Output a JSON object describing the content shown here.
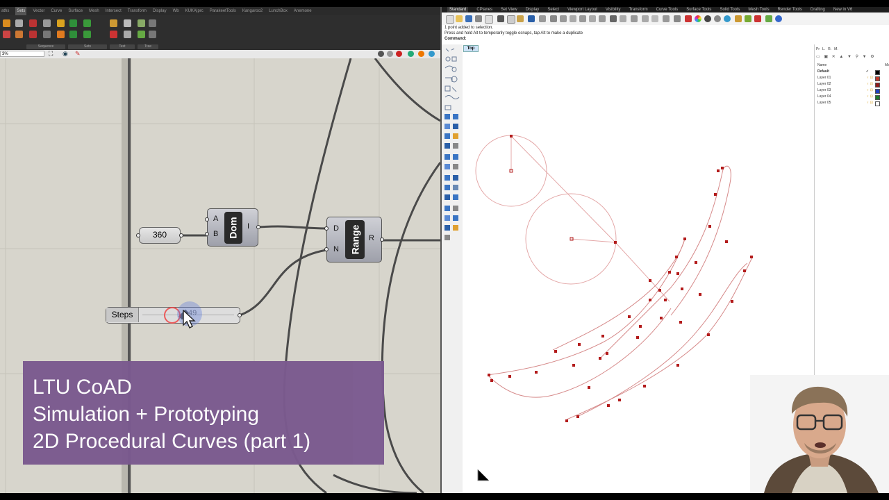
{
  "grasshopper": {
    "tabs": [
      "aths",
      "Sets",
      "Vector",
      "Curve",
      "Surface",
      "Mesh",
      "Intersect",
      "Transform",
      "Display",
      "Wb",
      "KUKA|prc",
      "ParakeetTools",
      "Kangaroo2",
      "LunchBox",
      "Anemone"
    ],
    "active_tab": "Sets",
    "ribbon_groups": [
      "Sequence",
      "Sets",
      "Text",
      "Tree"
    ],
    "zoom_value": "3%",
    "components": {
      "number_panel": "360",
      "domain": {
        "label": "Dom",
        "in_a": "A",
        "in_b": "B",
        "out": "I"
      },
      "range": {
        "label": "Range",
        "in_d": "D",
        "in_n": "N",
        "out": "R"
      },
      "slider": {
        "label": "Steps",
        "value": "49"
      }
    }
  },
  "rhino": {
    "tabs": [
      "Standard",
      "CPlanes",
      "Set View",
      "Display",
      "Select",
      "Viewport Layout",
      "Visibility",
      "Transform",
      "Curve Tools",
      "Surface Tools",
      "Solid Tools",
      "Mesh Tools",
      "Render Tools",
      "Drafting",
      "New in V6"
    ],
    "active_tab": "Standard",
    "command_history": [
      "1 point added to selection.",
      "Press and hold Alt to temporarily toggle osnaps, tap Alt to make a duplicate"
    ],
    "command_prompt": "Command:",
    "viewport_label": "Top",
    "panel_tabs": [
      "Pr",
      "L.",
      "R.",
      "M."
    ],
    "layers_header": {
      "name": "Name",
      "material": "Ma"
    },
    "layers": [
      {
        "name": "Default",
        "color": "#000000",
        "current": true
      },
      {
        "name": "Layer 01",
        "color": "#c0392b",
        "current": false
      },
      {
        "name": "Layer 02",
        "color": "#8e1b1b",
        "current": false
      },
      {
        "name": "Layer 03",
        "color": "#1f3fbf",
        "current": false
      },
      {
        "name": "Layer 04",
        "color": "#1d7a2a",
        "current": false
      },
      {
        "name": "Layer 05",
        "color": "#ffffff",
        "current": false
      }
    ]
  },
  "overlay": {
    "line1": "LTU CoAD",
    "line2": "Simulation + Prototyping",
    "line3": "2D Procedural Curves (part 1)",
    "bg_color": "#7b5a8f"
  }
}
